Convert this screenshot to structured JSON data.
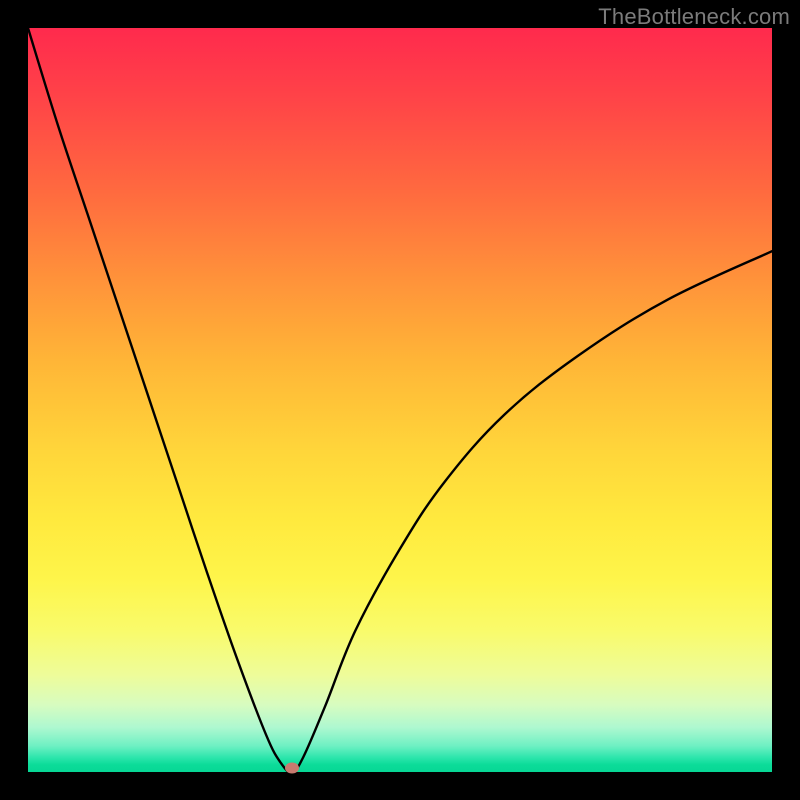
{
  "watermark": "TheBottleneck.com",
  "colors": {
    "frame": "#000000",
    "curve": "#000000",
    "dot": "#c77a6f",
    "watermark_text": "#7b7b7b",
    "gradient_top": "#ff2a4d",
    "gradient_bottom": "#07d795"
  },
  "chart_data": {
    "type": "line",
    "title": "",
    "xlabel": "",
    "ylabel": "",
    "xlim": [
      0,
      100
    ],
    "ylim": [
      0,
      100
    ],
    "grid": false,
    "series": [
      {
        "name": "bottleneck-curve",
        "x": [
          0,
          4,
          8,
          12,
          16,
          20,
          24,
          28,
          32,
          34,
          35.5,
          37,
          40,
          44,
          50,
          56,
          64,
          74,
          86,
          100
        ],
        "y": [
          100,
          87,
          75,
          63,
          51,
          39,
          27,
          15.5,
          5,
          1.2,
          0,
          2,
          9,
          19,
          30,
          39,
          48,
          56,
          63.5,
          70
        ]
      }
    ],
    "annotations": [
      {
        "name": "minimum-dot",
        "x": 35.5,
        "y": 0
      }
    ]
  }
}
